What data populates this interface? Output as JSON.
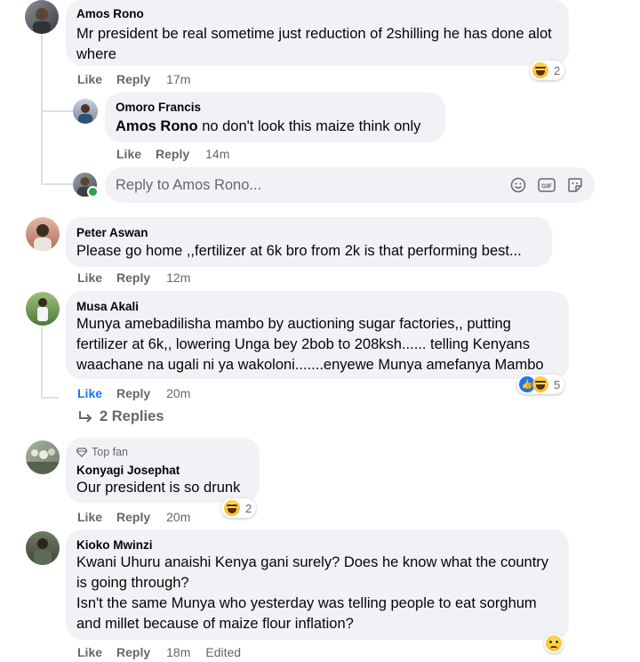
{
  "comments": [
    {
      "author": "Amos Rono",
      "text": "Mr president be real sometime just reduction of 2shilling he has done alot where",
      "actions": {
        "like": "Like",
        "reply": "Reply",
        "time": "17m"
      },
      "reaction_count": "2"
    },
    {
      "author": "Omoro Francis",
      "mention": "Amos Rono",
      "text": "no don't look this maize think only",
      "actions": {
        "like": "Like",
        "reply": "Reply",
        "time": "14m"
      }
    },
    {
      "author": "Peter Aswan",
      "text": "Please go home ,,fertilizer at 6k bro from 2k is that performing best...",
      "actions": {
        "like": "Like",
        "reply": "Reply",
        "time": "12m"
      }
    },
    {
      "author": "Musa Akali",
      "text": "Munya amebadilisha mambo by auctioning sugar factories,, putting fertilizer at 6k,, lowering Unga bey 2bob to 208ksh...... telling Kenyans waachane na ugali ni ya wakoloni.......enyewe Munya amefanya Mambo",
      "actions": {
        "like": "Like",
        "reply": "Reply",
        "time": "20m"
      },
      "reaction_count": "5",
      "replies_label": "2 Replies"
    },
    {
      "badge": "Top fan",
      "author": "Konyagi Josephat",
      "text": "Our president is so drunk",
      "actions": {
        "like": "Like",
        "reply": "Reply",
        "time": "20m"
      },
      "reaction_count": "2"
    },
    {
      "author": "Kioko Mwinzi",
      "text_lines": [
        "Kwani Uhuru anaishi Kenya gani surely? Does he know what the country is going through?",
        "Isn't the same Munya who yesterday was telling people to eat sorghum and millet because of maize flour inflation?"
      ],
      "actions": {
        "like": "Like",
        "reply": "Reply",
        "time": "18m",
        "edited": "Edited"
      }
    }
  ],
  "reply_box": {
    "placeholder": "Reply to Amos Rono..."
  },
  "colors": {
    "bubble": "#f0f2f5",
    "link_blue": "#1877f2",
    "secondary_text": "#65676b",
    "thread_line": "#dbe0e6",
    "online_dot": "#31a24c"
  },
  "icons": {
    "reply_tools": [
      "emoji-icon",
      "gif-icon",
      "sticker-icon"
    ],
    "replies_arrow": "reply-arrow-icon",
    "badge": "diamond-icon"
  }
}
